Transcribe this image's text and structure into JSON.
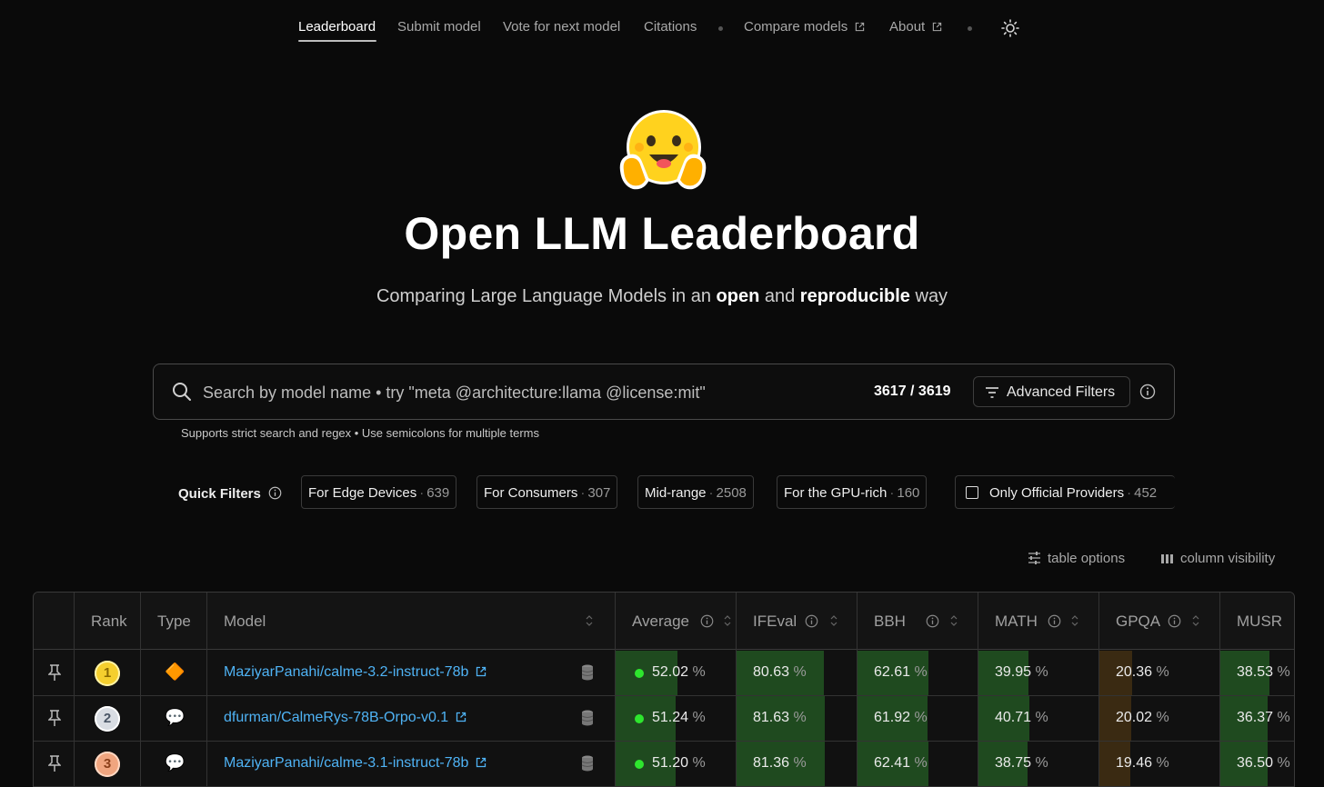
{
  "nav": {
    "items": [
      {
        "label": "Leaderboard",
        "active": true
      },
      {
        "label": "Submit model"
      },
      {
        "label": "Vote for next model"
      },
      {
        "label": "Citations"
      },
      {
        "label": "Compare models",
        "external": true
      },
      {
        "label": "About",
        "external": true
      }
    ],
    "theme_icon": "sun-icon"
  },
  "hero": {
    "emoji": "hugging-face-emoji",
    "title": "Open LLM Leaderboard",
    "subtitle_parts": [
      "Comparing Large Language Models in an ",
      "open",
      " and ",
      "reproducible",
      " way"
    ]
  },
  "search": {
    "placeholder": "Search by model name • try \"meta @architecture:llama @license:mit\"",
    "value": "",
    "count": "3617 / 3619",
    "advanced_label": "Advanced Filters",
    "hint": "Supports strict search and regex • Use semicolons for multiple terms"
  },
  "quick_filters": {
    "label": "Quick Filters",
    "chips": [
      {
        "label": "For Edge Devices",
        "count": "639"
      },
      {
        "label": "For Consumers",
        "count": "307"
      },
      {
        "label": "Mid-range",
        "count": "2508"
      },
      {
        "label": "For the GPU-rich",
        "count": "160"
      },
      {
        "label": "Only Official Providers",
        "count": "452",
        "checkbox": true,
        "checked": false
      }
    ]
  },
  "table_controls": {
    "options_label": "table options",
    "visibility_label": "column visibility"
  },
  "table": {
    "headers": {
      "rank": "Rank",
      "type": "Type",
      "model": "Model",
      "average": "Average",
      "ifeval": "IFEval",
      "bbh": "BBH",
      "math": "MATH",
      "gpqa": "GPQA",
      "musr": "MUSR"
    },
    "percent_suffix": "%",
    "rows": [
      {
        "rank": "1",
        "type_icon": "orange-diamond-icon",
        "type_glyph": "🔶",
        "model": "MaziyarPanahi/calme-3.2-instruct-78b",
        "average": "52.02",
        "ifeval": "80.63",
        "bbh": "62.61",
        "math": "39.95",
        "gpqa": "20.36",
        "musr": "38.53"
      },
      {
        "rank": "2",
        "type_icon": "chat-bubble-icon",
        "type_glyph": "💬",
        "model": "dfurman/CalmeRys-78B-Orpo-v0.1",
        "average": "51.24",
        "ifeval": "81.63",
        "bbh": "61.92",
        "math": "40.71",
        "gpqa": "20.02",
        "musr": "36.37"
      },
      {
        "rank": "3",
        "type_icon": "chat-bubble-icon",
        "type_glyph": "💬",
        "model": "MaziyarPanahi/calme-3.1-instruct-78b",
        "average": "51.20",
        "ifeval": "81.36",
        "bbh": "62.41",
        "math": "38.75",
        "gpqa": "19.46",
        "musr": "36.50"
      }
    ]
  },
  "colors": {
    "background": "#0a0a0a",
    "link": "#4fb3f5",
    "score_bar_green": "#1f4a1f",
    "score_bar_brown": "#3a2a12",
    "status_dot": "#2ee62e",
    "gold": "#f5cf2e",
    "silver": "#d9dde3",
    "bronze": "#f0a57f"
  }
}
